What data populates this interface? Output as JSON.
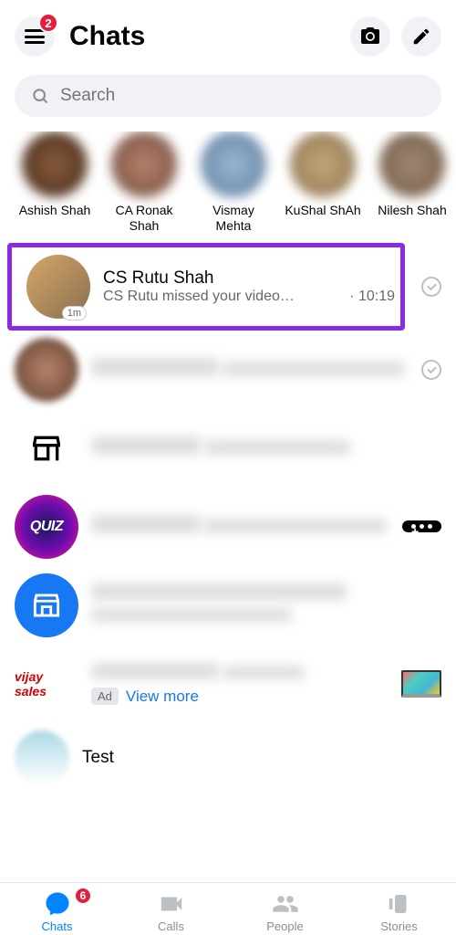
{
  "header": {
    "title": "Chats",
    "notification_count": "2"
  },
  "search": {
    "placeholder": "Search"
  },
  "stories": [
    {
      "name": "Ashish Shah"
    },
    {
      "name": "CA Ronak Shah"
    },
    {
      "name": "Vismay Mehta"
    },
    {
      "name": "KuShal ShAh"
    },
    {
      "name": "Nilesh Shah"
    }
  ],
  "chats": {
    "highlighted": {
      "name": "CS Rutu Shah",
      "preview": "CS Rutu missed your video…",
      "time": "10:19",
      "avatar_badge": "1m"
    },
    "ad": {
      "brand": "vijay sales",
      "label": "Ad",
      "link": "View more"
    },
    "last": {
      "name": "Test"
    }
  },
  "icons": {
    "quiz": "QUIZ"
  },
  "bottom_nav": {
    "chats": {
      "label": "Chats",
      "badge": "6"
    },
    "calls": {
      "label": "Calls"
    },
    "people": {
      "label": "People"
    },
    "stories": {
      "label": "Stories"
    }
  }
}
